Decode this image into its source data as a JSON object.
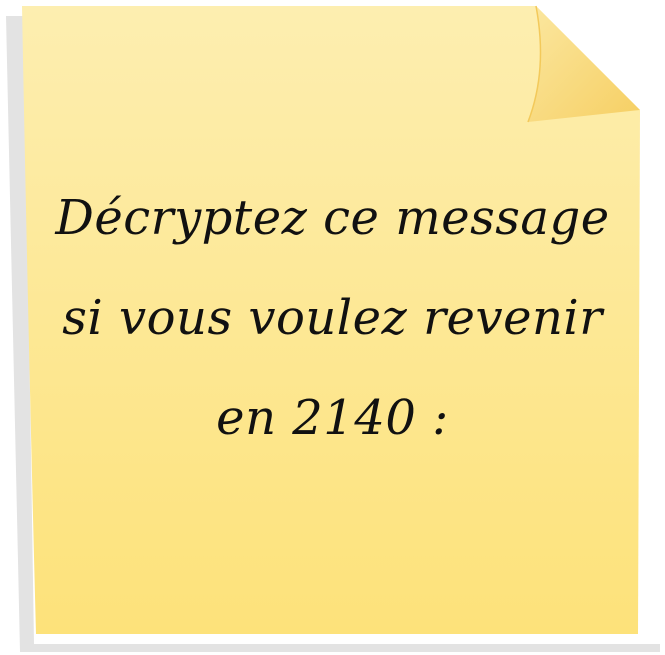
{
  "note": {
    "lines": [
      "Décryptez ce message",
      "si vous voulez revenir",
      "en 2140 :"
    ],
    "colors": {
      "paper_top": "#fdeeb0",
      "paper_bottom": "#fde27a",
      "fold": "#fbd97a",
      "shadow": "#e3e3e3",
      "ink": "#111111"
    }
  }
}
